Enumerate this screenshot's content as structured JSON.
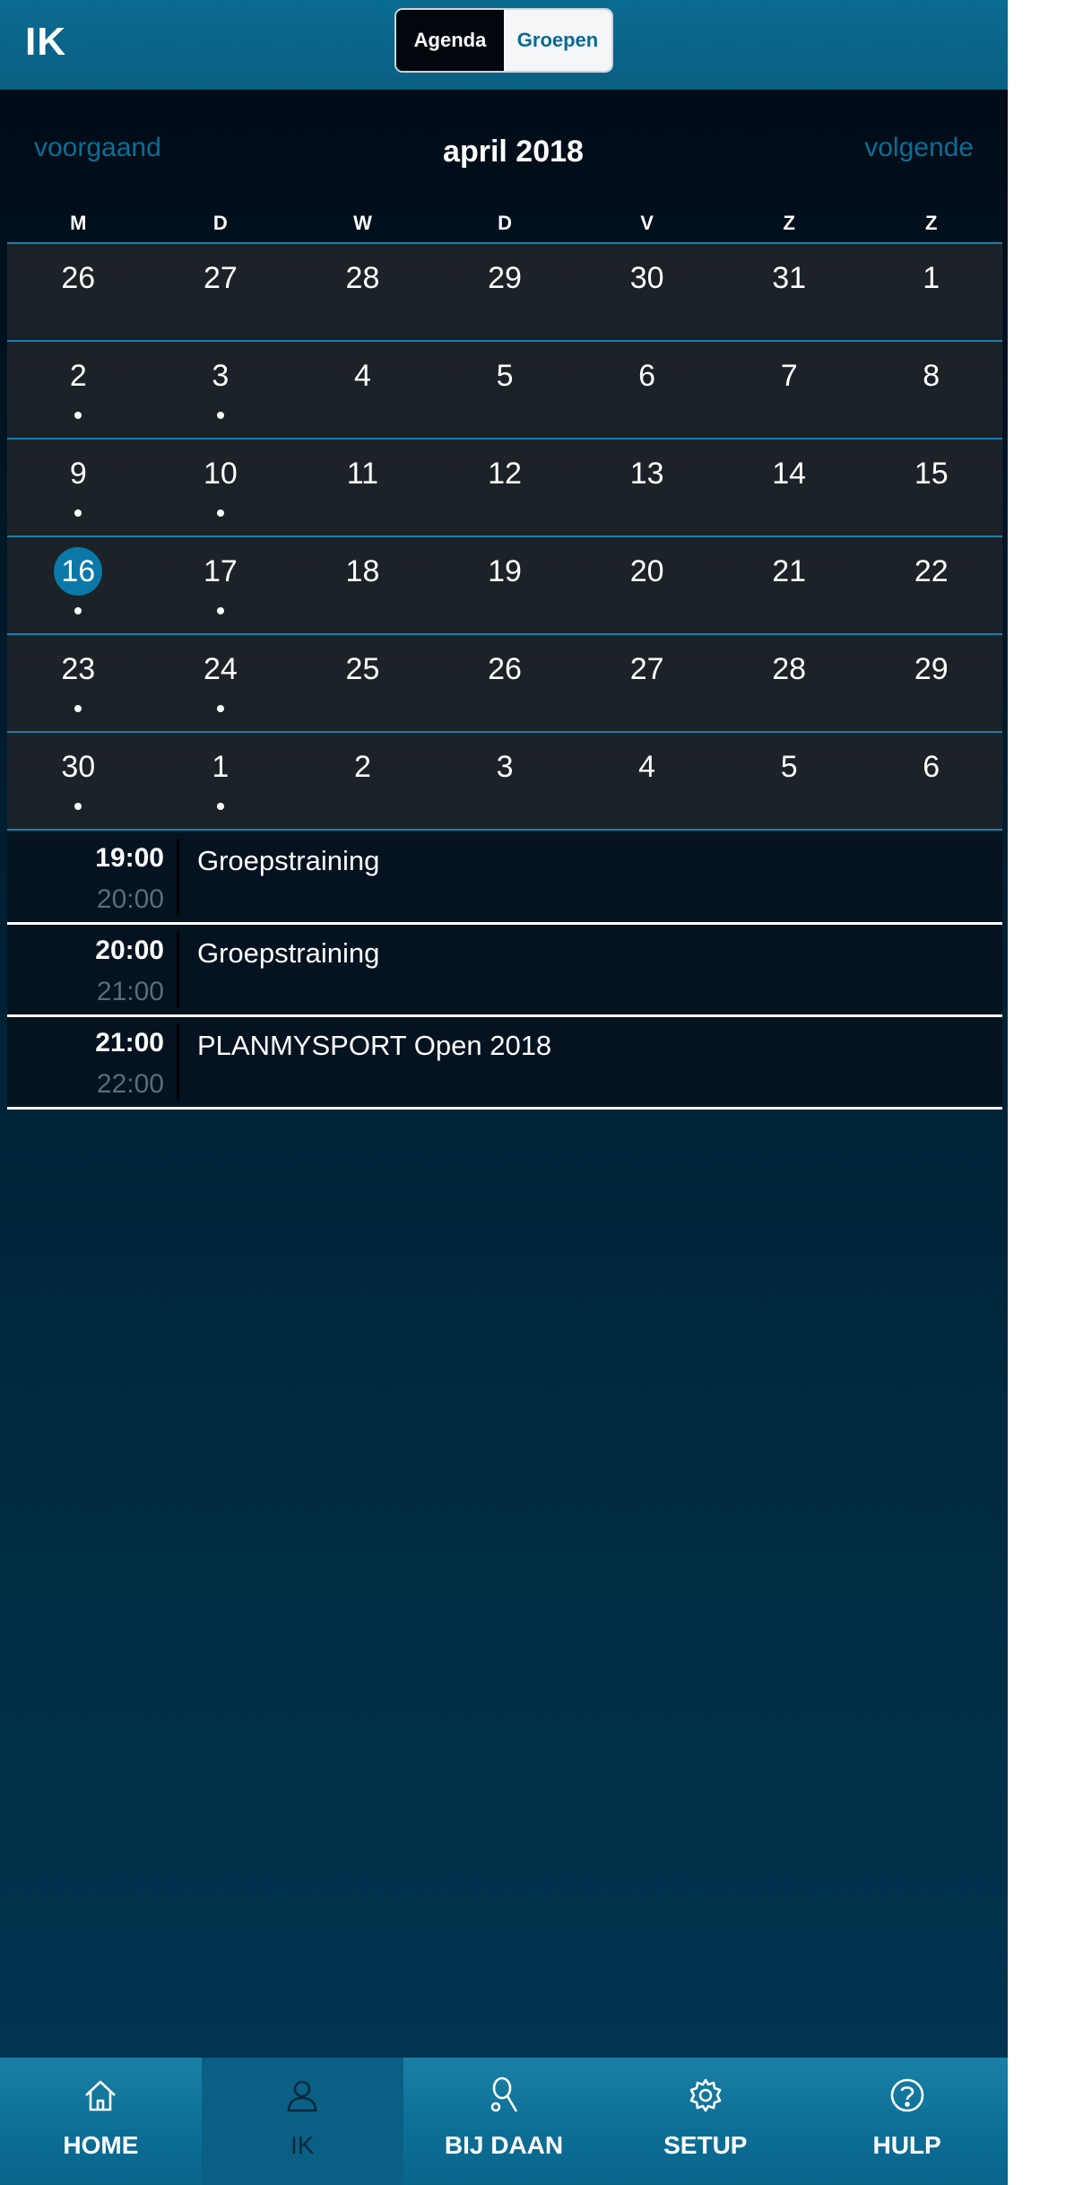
{
  "header": {
    "title": "IK",
    "segments": [
      {
        "label": "Agenda",
        "active": true
      },
      {
        "label": "Groepen",
        "active": false
      }
    ]
  },
  "month_nav": {
    "prev_label": "voorgaand",
    "month_label": "april 2018",
    "next_label": "volgende"
  },
  "weekdays": [
    "M",
    "D",
    "W",
    "D",
    "V",
    "Z",
    "Z"
  ],
  "weeks": [
    [
      {
        "d": "26"
      },
      {
        "d": "27"
      },
      {
        "d": "28"
      },
      {
        "d": "29"
      },
      {
        "d": "30"
      },
      {
        "d": "31"
      },
      {
        "d": "1"
      }
    ],
    [
      {
        "d": "2",
        "dot": true
      },
      {
        "d": "3",
        "dot": true
      },
      {
        "d": "4"
      },
      {
        "d": "5"
      },
      {
        "d": "6"
      },
      {
        "d": "7"
      },
      {
        "d": "8"
      }
    ],
    [
      {
        "d": "9",
        "dot": true
      },
      {
        "d": "10",
        "dot": true
      },
      {
        "d": "11"
      },
      {
        "d": "12"
      },
      {
        "d": "13"
      },
      {
        "d": "14"
      },
      {
        "d": "15"
      }
    ],
    [
      {
        "d": "16",
        "dot": true,
        "today": true
      },
      {
        "d": "17",
        "dot": true
      },
      {
        "d": "18"
      },
      {
        "d": "19"
      },
      {
        "d": "20"
      },
      {
        "d": "21"
      },
      {
        "d": "22"
      }
    ],
    [
      {
        "d": "23",
        "dot": true
      },
      {
        "d": "24",
        "dot": true
      },
      {
        "d": "25"
      },
      {
        "d": "26"
      },
      {
        "d": "27"
      },
      {
        "d": "28"
      },
      {
        "d": "29"
      }
    ],
    [
      {
        "d": "30",
        "dot": true
      },
      {
        "d": "1",
        "dot": true
      },
      {
        "d": "2"
      },
      {
        "d": "3"
      },
      {
        "d": "4"
      },
      {
        "d": "5"
      },
      {
        "d": "6"
      }
    ]
  ],
  "events": [
    {
      "start": "19:00",
      "end": "20:00",
      "title": "Groepstraining"
    },
    {
      "start": "20:00",
      "end": "21:00",
      "title": "Groepstraining"
    },
    {
      "start": "21:00",
      "end": "22:00",
      "title": "PLANMYSPORT Open 2018"
    }
  ],
  "bottom_nav": [
    {
      "label": "HOME",
      "icon": "home-icon",
      "active": false
    },
    {
      "label": "IK",
      "icon": "user-icon",
      "active": true
    },
    {
      "label": "BIJ DAAN",
      "icon": "tennis-racket-icon",
      "active": false
    },
    {
      "label": "SETUP",
      "icon": "gear-icon",
      "active": false
    },
    {
      "label": "HULP",
      "icon": "help-icon",
      "active": false
    }
  ],
  "colors": {
    "accent": "#0a79a8",
    "header": "#0a5f82",
    "grid_line": "#1a7fae"
  }
}
